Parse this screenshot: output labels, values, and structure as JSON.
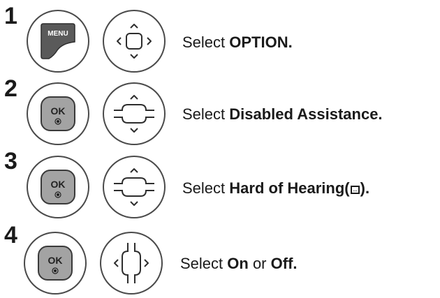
{
  "steps": [
    {
      "num": "1",
      "prefix": "Select ",
      "bold": "OPTION.",
      "key_label": "MENU"
    },
    {
      "num": "2",
      "prefix": "Select ",
      "bold": "Disabled Assistance.",
      "ok_label": "OK"
    },
    {
      "num": "3",
      "prefix": "Select ",
      "bold_a": "Hard of Hearing(",
      "bold_b": ").",
      "ok_label": "OK"
    },
    {
      "num": "4",
      "prefix": "Select ",
      "bold_a": "On",
      "mid": " or ",
      "bold_b": "Off.",
      "ok_label": "OK"
    }
  ],
  "icons": {
    "step1_a": "menu-key-icon",
    "step1_b": "four-way-nav-icon",
    "step2_b": "up-down-nav-icon",
    "step3_b": "up-down-nav-icon",
    "step4_b": "left-right-nav-icon",
    "ok": "ok-button-icon",
    "subtitle": "subtitle-icon"
  }
}
